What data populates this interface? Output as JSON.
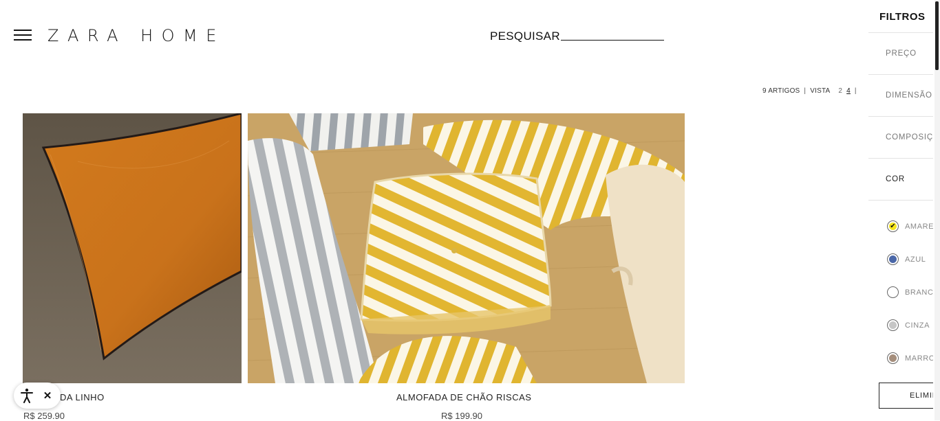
{
  "header": {
    "logo": "ZARA HOME",
    "search_label": "PESQUISAR"
  },
  "viewbar": {
    "count": "9 ARTIGOS",
    "separator": "|",
    "view_label": "VISTA",
    "options": [
      "2",
      "4"
    ],
    "active_option": "4",
    "trailing": "|"
  },
  "products": [
    {
      "name": "DA LINHO",
      "price": "R$ 259.90"
    },
    {
      "name": "ALMOFADA DE CHÃO RISCAS",
      "price": "R$ 199.90"
    }
  ],
  "filters": {
    "title": "FILTROS",
    "sections": [
      "PREÇO",
      "DIMENSÃO",
      "COMPOSIÇÃ",
      "COR"
    ],
    "colors": [
      {
        "label": "AMARE",
        "hex": "#f5e51f",
        "checked": true
      },
      {
        "label": "AZUL",
        "hex": "#4a67a8",
        "checked": false
      },
      {
        "label": "BRANCO",
        "hex": "#ffffff",
        "checked": false
      },
      {
        "label": "CINZA",
        "hex": "#c6c6c6",
        "checked": false
      },
      {
        "label": "MARRO",
        "hex": "#a58e7c",
        "checked": false
      }
    ],
    "clear_button": "ELIMIN"
  },
  "accessibility": {
    "icon": "accessibility-icon",
    "close": "✕"
  }
}
